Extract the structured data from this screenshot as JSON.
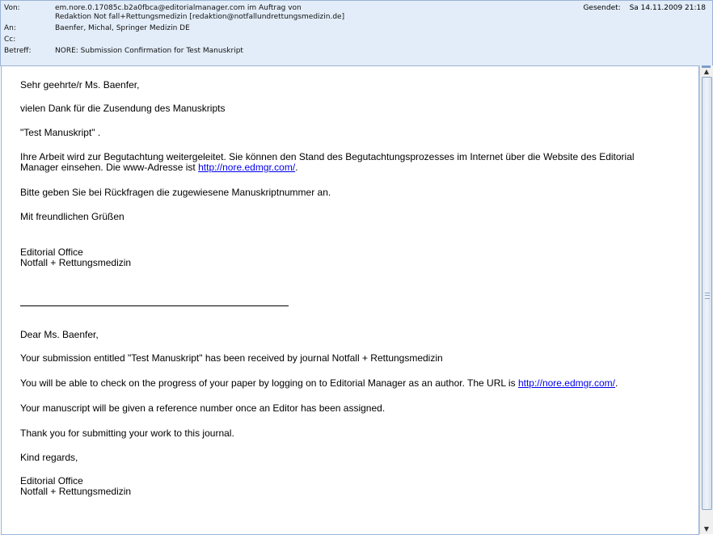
{
  "header": {
    "from_label": "Von:",
    "from_value_line1": "em.nore.0.17085c.b2a0fbca@editorialmanager.com im Auftrag von",
    "from_value_line2": "Redaktion Not fall+Rettungsmedizin [redaktion@notfallundrettungsmedizin.de]",
    "sent_label": "Gesendet:",
    "sent_value": "Sa 14.11.2009 21:18",
    "to_label": "An:",
    "to_value": "Baenfer, Michal, Springer Medizin DE",
    "cc_label": "Cc:",
    "cc_value": "",
    "subject_label": "Betreff:",
    "subject_value": "NORE: Submission Confirmation for Test Manuskript"
  },
  "body": {
    "greeting_de": "Sehr geehrte/r Ms. Baenfer,",
    "thanks_de": "vielen Dank für die Zusendung des Manuskripts",
    "title_de": "\"Test Manuskript\" .",
    "review_de_line1": "Ihre Arbeit wird zur Begutachtung weitergeleitet. Sie können den Stand des Begutachtungsprozesses im Internet über die Website des Editorial",
    "review_de_line2_prefix": "Manager einsehen. Die www-Adresse ist ",
    "review_de_link": "http://nore.edmgr.com/",
    "review_de_line2_suffix": ".",
    "reference_de": "Bitte geben Sie bei Rückfragen die zugewiesene Manuskriptnummer an.",
    "closing_de": "Mit freundlichen Grüßen",
    "sig_de_line1": "Editorial Office",
    "sig_de_line2": "Notfall + Rettungsmedizin",
    "greeting_en": "Dear Ms. Baenfer,",
    "received_en": "Your submission entitled \"Test Manuskript\" has been received by journal Notfall + Rettungsmedizin",
    "progress_en_prefix": "You will be able to check on the progress of your paper by logging on to Editorial Manager as an author. The URL is ",
    "progress_en_link": "http://nore.edmgr.com/",
    "progress_en_suffix": ".",
    "reference_en": "Your manuscript will be given a reference number once an Editor has been assigned.",
    "thanks_en": "Thank you for submitting your work to this journal.",
    "closing_en": "Kind regards,",
    "sig_en_line1": "Editorial Office",
    "sig_en_line2": "Notfall + Rettungsmedizin"
  },
  "scrollbar": {
    "up_icon": "arrow-up-icon",
    "down_icon": "arrow-down-icon"
  }
}
